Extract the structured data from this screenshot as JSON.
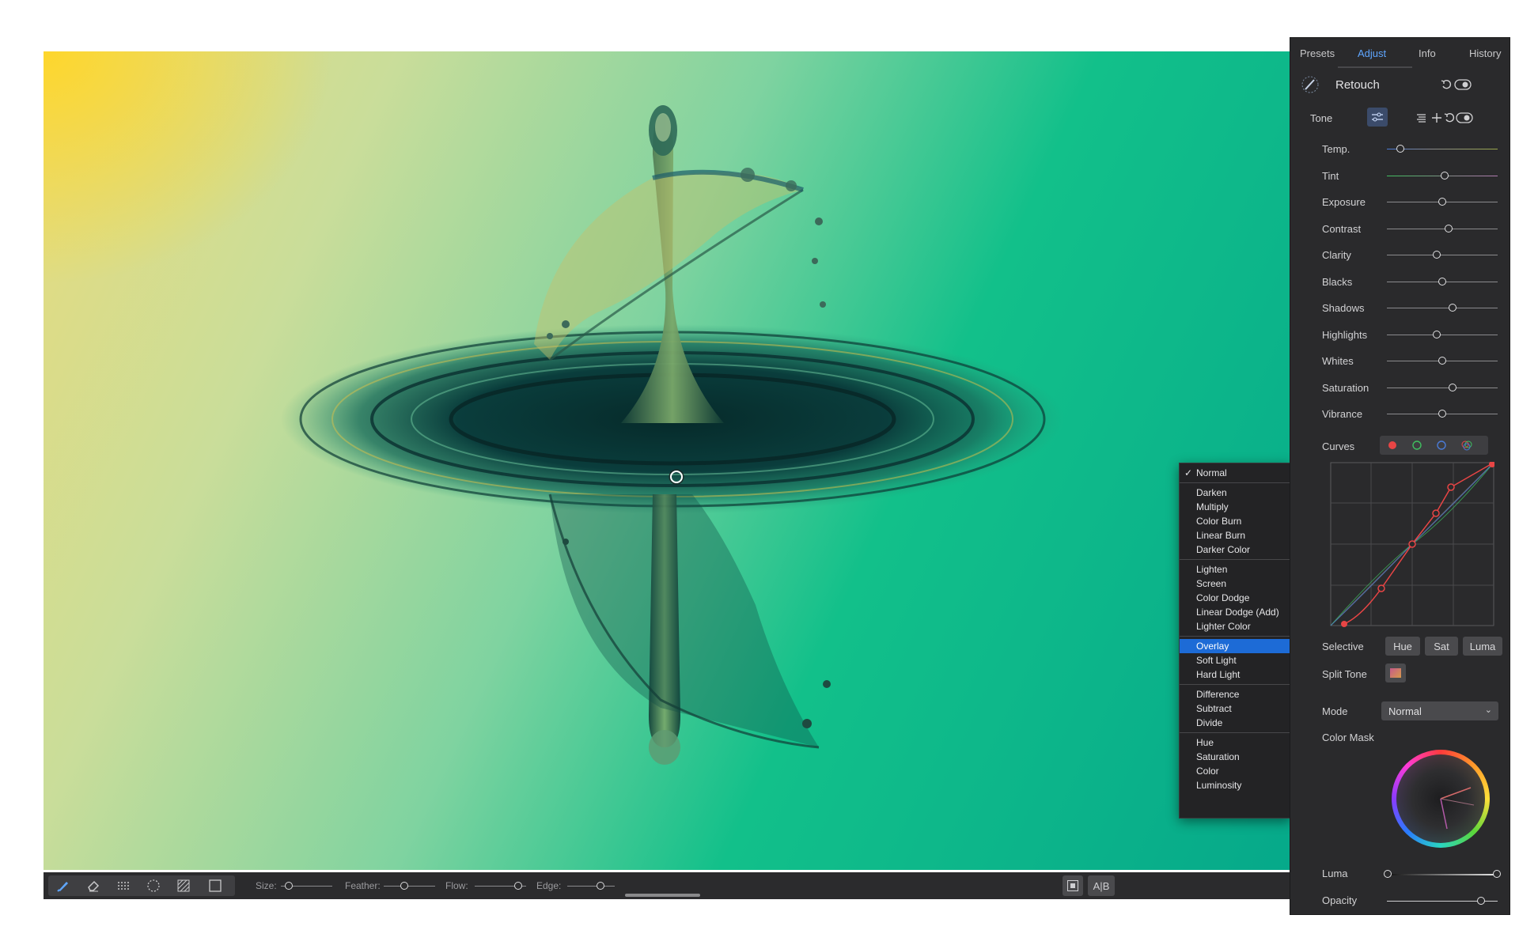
{
  "toolbar": {
    "tools": [
      {
        "icon": "brush-icon"
      },
      {
        "icon": "eraser-icon"
      },
      {
        "icon": "gradient-lines-icon"
      },
      {
        "icon": "lasso-circle-icon"
      },
      {
        "icon": "hatch-fill-icon"
      },
      {
        "icon": "rectangle-icon"
      }
    ],
    "size_label": "Size:",
    "size_value": 0.15,
    "feather_label": "Feather:",
    "feather_value": 0.4,
    "flow_label": "Flow:",
    "flow_value": 0.85,
    "edge_label": "Edge:",
    "edge_value": 0.7,
    "compare_label": "A|B"
  },
  "blend_menu": {
    "selected_index": 0,
    "highlighted": "Overlay",
    "groups": [
      [
        "Normal"
      ],
      [
        "Darken",
        "Multiply",
        "Color Burn",
        "Linear Burn",
        "Darker Color"
      ],
      [
        "Lighten",
        "Screen",
        "Color Dodge",
        "Linear Dodge (Add)",
        "Lighter Color"
      ],
      [
        "Overlay",
        "Soft Light",
        "Hard Light"
      ],
      [
        "Difference",
        "Subtract",
        "Divide"
      ],
      [
        "Hue",
        "Saturation",
        "Color",
        "Luminosity"
      ]
    ]
  },
  "panel": {
    "tabs": [
      "Presets",
      "Adjust",
      "Info",
      "History"
    ],
    "active_tab": "Adjust",
    "title": "Retouch",
    "section": "Tone",
    "sliders": [
      {
        "label": "Temp.",
        "value": 0.12
      },
      {
        "label": "Tint",
        "value": 0.52
      },
      {
        "label": "Exposure",
        "value": 0.5
      },
      {
        "label": "Contrast",
        "value": 0.56
      },
      {
        "label": "Clarity",
        "value": 0.45
      },
      {
        "label": "Blacks",
        "value": 0.5
      },
      {
        "label": "Shadows",
        "value": 0.59
      },
      {
        "label": "Highlights",
        "value": 0.45
      },
      {
        "label": "Whites",
        "value": 0.5
      },
      {
        "label": "Saturation",
        "value": 0.59
      },
      {
        "label": "Vibrance",
        "value": 0.5
      }
    ],
    "curves_label": "Curves",
    "curve_channels": [
      "red",
      "green",
      "blue",
      "rgb"
    ],
    "colors": {
      "red": "#e84545",
      "green": "#3fbf5f",
      "blue": "#4a7bd6",
      "accent": "#5fa6ff"
    },
    "selective_label": "Selective",
    "selective_buttons": [
      "Hue",
      "Sat",
      "Luma"
    ],
    "split_tone_label": "Split Tone",
    "mode_label": "Mode",
    "mode_value": "Normal",
    "color_mask_label": "Color Mask",
    "luma_label": "Luma",
    "opacity_label": "Opacity",
    "opacity_value": 0.85
  }
}
